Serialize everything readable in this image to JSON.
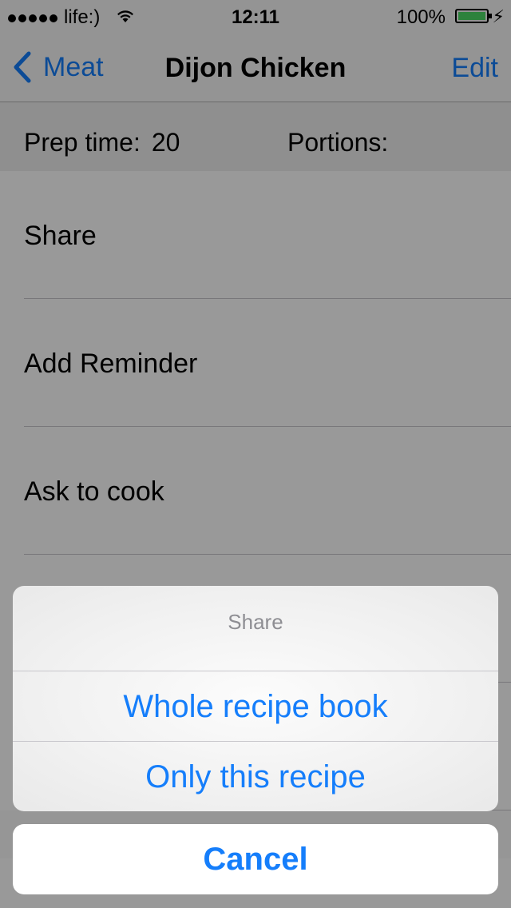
{
  "status_bar": {
    "carrier": "life:)",
    "time": "12:11",
    "battery_percent": "100%",
    "signal_icon": "signal-dots-icon",
    "wifi_icon": "wifi-icon",
    "battery_icon": "battery-icon",
    "charging_icon": "bolt-icon"
  },
  "nav": {
    "back_label": "Meat",
    "title": "Dijon Chicken",
    "edit_label": "Edit",
    "back_icon": "chevron-left-icon"
  },
  "info": {
    "prep_label": "Prep time:",
    "prep_value": "20",
    "portions_label": "Portions:"
  },
  "list": {
    "items": [
      {
        "label": "Share"
      },
      {
        "label": "Add Reminder"
      },
      {
        "label": "Ask to cook"
      }
    ]
  },
  "action_sheet": {
    "title": "Share",
    "actions": [
      {
        "label": "Whole recipe book"
      },
      {
        "label": "Only this recipe"
      }
    ],
    "cancel_label": "Cancel"
  },
  "colors": {
    "accent": "#157efb",
    "overlay": "rgba(0,0,0,0.4)"
  }
}
